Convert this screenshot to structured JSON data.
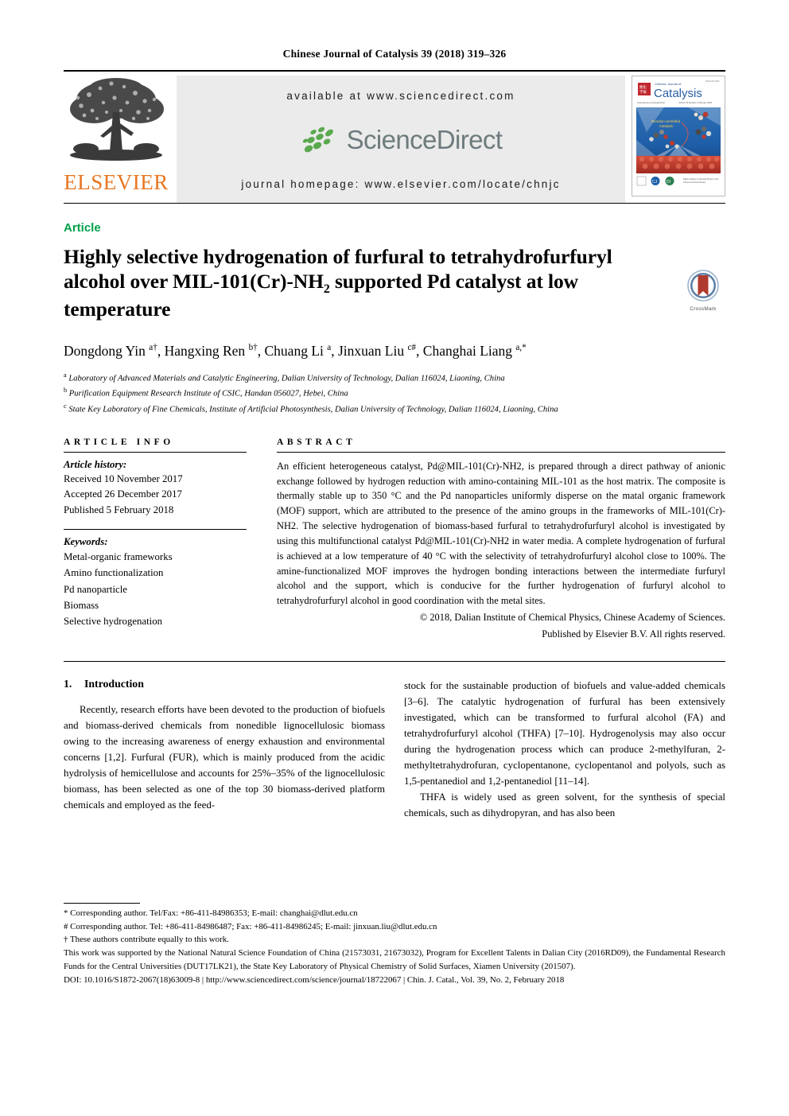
{
  "running_head": "Chinese Journal of Catalysis 39 (2018) 319–326",
  "masthead": {
    "publisher": "ELSEVIER",
    "available_at": "available at www.sciencedirect.com",
    "sciencedirect": "ScienceDirect",
    "journal_homepage": "journal homepage: www.elsevier.com/locate/chnjc",
    "cover": {
      "journal_prefix": "Chinese Journal of",
      "journal_name": "Catalysis",
      "cover_caption": "Reaction-controlled Catalysis",
      "issue_line": "Volume 39  Number 2  February 2018",
      "url_line": "www.elsevier.com/locate/chnjc"
    }
  },
  "article_tag": "Article",
  "title": {
    "line1": "Highly selective hydrogenation of furfural to tetrahydrofurfuryl",
    "line2_a": "alcohol over MIL-101(Cr)-NH",
    "line2_sub": "2",
    "line2_b": " supported Pd catalyst at low",
    "line3": "temperature"
  },
  "crossmark_label": "CrossMark",
  "authors": "Dongdong Yin a†, Hangxing Ren b†, Chuang Li a, Jinxuan Liu c#, Changhai Liang a,*",
  "affiliations": [
    {
      "marker": "a",
      "text": "Laboratory of Advanced Materials and Catalytic Engineering, Dalian University of Technology, Dalian 116024, Liaoning,  China"
    },
    {
      "marker": "b",
      "text": "Purification Equipment Research Institute of CSIC, Handan 056027, Hebei, China"
    },
    {
      "marker": "c",
      "text": "State Key Laboratory of Fine Chemicals, Institute of Artificial Photosynthesis, Dalian University of Technology, Dalian 116024, Liaoning, China"
    }
  ],
  "article_info": {
    "heading": "ARTICLE INFO",
    "history_heading": "Article history:",
    "received": "Received 10 November 2017",
    "accepted": "Accepted 26 December 2017",
    "published": "Published 5 February 2018",
    "keywords_heading": "Keywords:",
    "keywords": [
      "Metal-organic frameworks",
      "Amino functionalization",
      "Pd nanoparticle",
      "Biomass",
      "Selective hydrogenation"
    ]
  },
  "abstract": {
    "heading": "ABSTRACT",
    "text": "An efficient heterogeneous catalyst, Pd@MIL-101(Cr)-NH2, is prepared through a direct pathway of anionic exchange followed by hydrogen reduction with amino-containing MIL-101 as the host matrix. The composite is thermally stable up to 350 °C and the Pd nanoparticles uniformly disperse on the matal organic framework (MOF) support, which are attributed to the presence of the amino groups in the frameworks of MIL-101(Cr)-NH2. The selective hydrogenation of biomass-based furfural to tetrahydrofurfuryl alcohol is investigated by using this multifunctional catalyst Pd@MIL-101(Cr)-NH2 in water media. A complete hydrogenation of furfural is achieved at a low temperature of 40 °C with the selectivity of tetrahydrofurfuryl alcohol close to 100%. The amine-functionalized MOF improves the hydrogen bonding interactions between the intermediate furfuryl alcohol and the support, which is conducive for the further hydrogenation of furfuryl alcohol to tetrahydrofurfuryl alcohol in good coordination with the metal sites.",
    "copyright_line1": "© 2018, Dalian Institute of Chemical Physics, Chinese Academy of Sciences.",
    "copyright_line2": "Published by Elsevier B.V. All rights reserved."
  },
  "body": {
    "section_number": "1.",
    "section_title": "Introduction",
    "left_paragraph": "Recently, research efforts have been devoted to the production of biofuels and biomass-derived chemicals from nonedible lignocellulosic biomass owing to the increasing awareness of energy exhaustion and environmental concerns [1,2]. Furfural (FUR), which is mainly produced from the acidic hydrolysis of hemicellulose and accounts for 25%–35% of the lignocellulosic biomass, has been selected as one of the top 30 biomass-derived platform chemicals and employed as the feed-",
    "right_paragraph_1": "stock for the sustainable production of biofuels and value-added chemicals [3–6]. The catalytic hydrogenation of furfural has been extensively investigated, which can be transformed to furfural alcohol (FA) and tetrahydrofurfuryl alcohol (THFA) [7–10]. Hydrogenolysis may also occur during the hydrogenation process which can produce 2-methylfuran, 2-methyltetrahydrofuran, cyclopentanone, cyclopentanol and polyols, such as 1,5-pentanediol and 1,2-pentanediol [11–14].",
    "right_paragraph_2": "THFA is widely used as green solvent, for the synthesis of special chemicals, such as dihydropyran, and has also been"
  },
  "footnotes": {
    "corresponding_1": "* Corresponding author. Tel/Fax: +86-411-84986353; E-mail: changhai@dlut.edu.cn",
    "corresponding_2": "# Corresponding author. Tel: +86-411-84986487; Fax: +86-411-84986245; E-mail: jinxuan.liu@dlut.edu.cn",
    "equal_contribution": "† These authors contribute equally to this work.",
    "funding": "This work was supported by the National Natural Science Foundation of China (21573031, 21673032), Program for Excellent Talents in Dalian City (2016RD09), the Fundamental Research Funds for the Central Universities (DUT17LK21), the State Key Laboratory of Physical Chemistry of Solid Surfaces, Xiamen University (201507).",
    "doi_line": "DOI: 10.1016/S1872-2067(18)63009-8 | http://www.sciencedirect.com/science/journal/18722067 | Chin. J. Catal., Vol. 39, No. 2, February 2018"
  },
  "colors": {
    "elsevier_orange": "#E87722",
    "article_green": "#00a14b",
    "sciencedirect_gray": "#6e7b7d",
    "sciencedirect_green": "#4caf50",
    "band_gray": "#ebebeb",
    "crossmark_blue": "#3b5f8a",
    "crossmark_red": "#b03a2e"
  }
}
